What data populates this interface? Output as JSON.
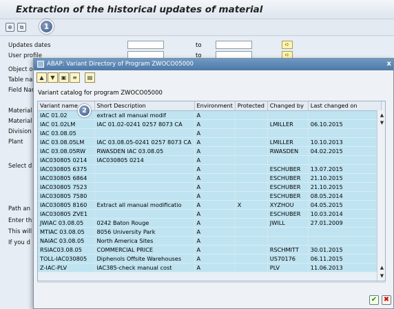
{
  "screen": {
    "title": "Extraction of the historical updates of material",
    "toolbar_badge": "1",
    "form_labels": [
      "Updates dates",
      "User profile",
      "Object o",
      "Table na",
      "Field Nar",
      "Material",
      "Material",
      "Division",
      "Plant",
      "Select d",
      "Path an",
      "Enter th",
      "This will",
      "If you d"
    ],
    "to_label": "to"
  },
  "dialog": {
    "title": "ABAP: Variant Directory of Program ZWOCO05000",
    "close": "x",
    "catalog_label": "Variant catalog for program ZWOCO05000",
    "row_badge": "2",
    "columns": [
      "Variant name",
      "Short Description",
      "Environment",
      "Protected",
      "Changed by",
      "Last changed on"
    ],
    "rows": [
      [
        "IAC 01.02",
        "extract all manual modif",
        "A",
        "",
        "",
        ""
      ],
      [
        "IAC 01.02LM",
        "IAC 01.02-0241 0257 8073 CA",
        "A",
        "",
        "LMILLER",
        "06.10.2015"
      ],
      [
        "IAC 03.08.05",
        "",
        "A",
        "",
        "",
        ""
      ],
      [
        "IAC 03.08.05LM",
        "IAC 03.08.05-0241 0257 8073 CA",
        "A",
        "",
        "LMILLER",
        "10.10.2013"
      ],
      [
        "IAC 03.08.05RW",
        "RWASDEN IAC 03.08.05",
        "A",
        "",
        "RWASDEN",
        "04.02.2015"
      ],
      [
        "IAC030805 0214",
        "IAC030805 0214",
        "A",
        "",
        "",
        ""
      ],
      [
        "IAC030805 6375",
        "",
        "A",
        "",
        "ESCHUBER",
        "13.07.2015"
      ],
      [
        "IAC030805 6864",
        "",
        "A",
        "",
        "ESCHUBER",
        "21.10.2015"
      ],
      [
        "IAC030805 7523",
        "",
        "A",
        "",
        "ESCHUBER",
        "21.10.2015"
      ],
      [
        "IAC030805 7580",
        "",
        "A",
        "",
        "ESCHUBER",
        "08.05.2014"
      ],
      [
        "IAC030805 8160",
        "Extract all manual modificatio",
        "A",
        "X",
        "XYZHOU",
        "04.05.2015"
      ],
      [
        "IAC030805 ZVE1",
        "",
        "A",
        "",
        "ESCHUBER",
        "10.03.2014"
      ],
      [
        "JWIAC 03.08.05",
        "0242 Baton Rouge",
        "A",
        "",
        "JWILL",
        "27.01.2009"
      ],
      [
        "MTIAC 03.08.05",
        "8056 University Park",
        "A",
        "",
        "",
        ""
      ],
      [
        "NAIAC 03.08.05",
        "North America Sites",
        "A",
        "",
        "",
        ""
      ],
      [
        "RSIAC03.08.05",
        "COMMERCIAL PRICE",
        "A",
        "",
        "RSCHMITT",
        "30.01.2015"
      ],
      [
        "TOLL-IAC030805",
        "Diphenols Offsite Warehouses",
        "A",
        "",
        "US70176",
        "06.11.2015"
      ],
      [
        "Z-IAC-PLV",
        "IAC385-check manual cost",
        "A",
        "",
        "PLV",
        "11.06.2013"
      ]
    ]
  },
  "icons": {
    "execute": "execute-icon",
    "variant": "get-variant-icon",
    "ok": "check-icon",
    "cancel": "cancel-icon"
  }
}
